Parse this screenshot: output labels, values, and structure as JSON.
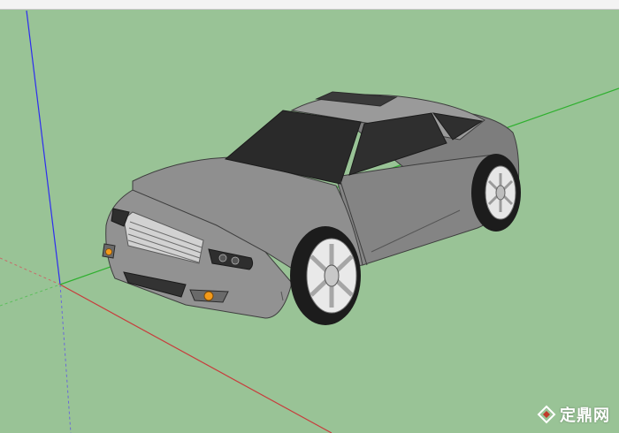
{
  "viewport": {
    "background_color": "#99c396",
    "axis_colors": {
      "blue": "#2d2df0",
      "red": "#c83c3c",
      "green": "#2fb02f"
    }
  },
  "model": {
    "body_color": "#8c8c8c",
    "glass_color": "#2a2a2a",
    "wheel_color": "#d8d8d8"
  },
  "watermark": {
    "text": "定鼎网",
    "icon": "logo-icon"
  }
}
